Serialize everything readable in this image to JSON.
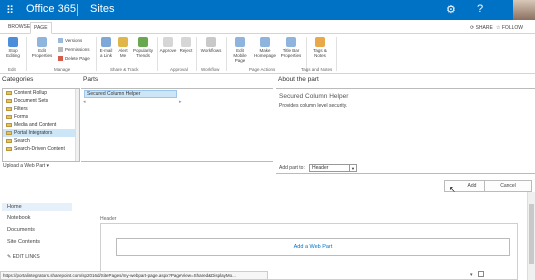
{
  "suite": {
    "brand": "Office 365",
    "section": "Sites",
    "icons": [
      "waffle-icon",
      "gear-icon",
      "help-icon",
      "avatar"
    ]
  },
  "ribbon_tabs": {
    "browse": "BROWSE",
    "page": "PAGE",
    "share": "SHARE",
    "follow": "FOLLOW"
  },
  "ribbon": {
    "stop_editing": "Stop Editing",
    "edit_properties": "Edit Properties",
    "versions": "Versions",
    "permissions": "Permissions",
    "delete_page": "Delete Page",
    "email_link": "E-mail a Link",
    "alert_me": "Alert Me",
    "popularity_trends": "Popularity Trends",
    "approve": "Approve",
    "reject": "Reject",
    "workflows": "Workflows",
    "edit_mobile": "Edit Mobile Page",
    "make_homepage": "Make Homepage",
    "title_bar_properties": "Title Bar Properties",
    "tags_notes": "Tags & Notes",
    "groups": {
      "edit": "Edit",
      "manage": "Manage",
      "share_track": "Share & Track",
      "approval": "Approval",
      "workflow": "Workflow",
      "page_actions": "Page Actions",
      "tags_notes": "Tags and Notes"
    }
  },
  "adder": {
    "categories_title": "Categories",
    "parts_title": "Parts",
    "about_title": "About the part",
    "categories": [
      "Content Rollup",
      "Document Sets",
      "Filters",
      "Forms",
      "Media and Content",
      "Portal Integrators",
      "Search",
      "Search-Driven Content"
    ],
    "selected_category": "Portal Integrators",
    "parts": [
      "Secured Column Helper"
    ],
    "about_name": "Secured Column Helper",
    "about_desc": "Provides column level security.",
    "add_part_to": "Add part to:",
    "zone": "Header",
    "upload": "Upload a Web Part",
    "add": "Add",
    "cancel": "Cancel"
  },
  "nav": {
    "items": [
      "Home",
      "Notebook",
      "Documents",
      "Site Contents"
    ],
    "edit_links": "EDIT LINKS"
  },
  "page": {
    "zone_label": "Header",
    "add_web_part": "Add a Web Part"
  },
  "status_url": "https://portalintegrators.sharepoint.com/sp2016d/SitePages/my-webpart-page.aspx?PageView=Shared&DisplayMo..."
}
